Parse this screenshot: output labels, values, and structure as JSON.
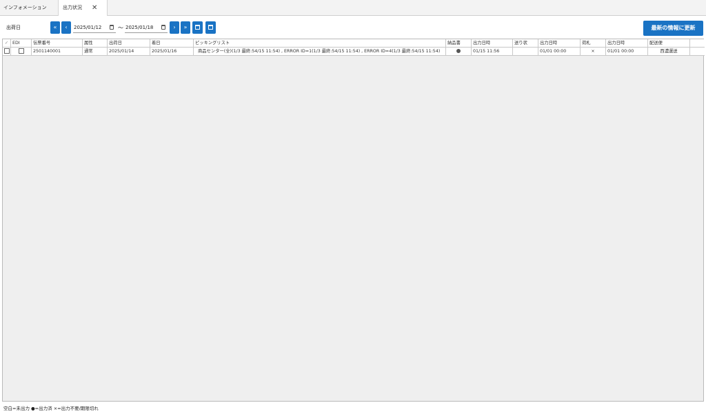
{
  "tabs": [
    {
      "label": "インフォメーション"
    },
    {
      "label": "出力状況",
      "close": "✕"
    }
  ],
  "toolbar": {
    "date_label": "出荷日",
    "first": "«",
    "prev": "‹",
    "next": "›",
    "last": "»",
    "date_from": "2025/01/12",
    "tilde": "～",
    "date_to": "2025/01/18",
    "refresh_label": "最新の情報に更新",
    "accent_color": "#1a73c4"
  },
  "table": {
    "headers": {
      "check": "✓",
      "edi": "EDI",
      "slip_no": "伝票番号",
      "attribute": "属性",
      "ship_date": "出荷日",
      "arrival_date": "着日",
      "picking_list": "ピッキングリスト",
      "delivery_note": "納品書",
      "out_dt1": "出力日時",
      "invoice": "送り状",
      "out_dt2": "出力日時",
      "tag": "荷札",
      "out_dt3": "出力日時",
      "carrier": "配送便"
    },
    "rows": [
      {
        "slip_no": "2501140001",
        "attribute": "通常",
        "ship_date": "2025/01/14",
        "arrival_date": "2025/01/16",
        "picking_list": "商品センター(全)(1/3 最終:54/15 11:54) , ERROR ID=1(1/3 最終:54/15 11:54) , ERROR ID=4(1/3 最終:54/15 11:54)",
        "delivery_note": "●",
        "out_dt1": "01/15 11:56",
        "invoice": "",
        "out_dt2": "01/01 00:00",
        "tag": "×",
        "out_dt3": "01/01 00:00",
        "carrier": "西濃運送"
      }
    ]
  },
  "legend": "空白=未出力 ●=出力済 ×=出力不要/期限切れ"
}
